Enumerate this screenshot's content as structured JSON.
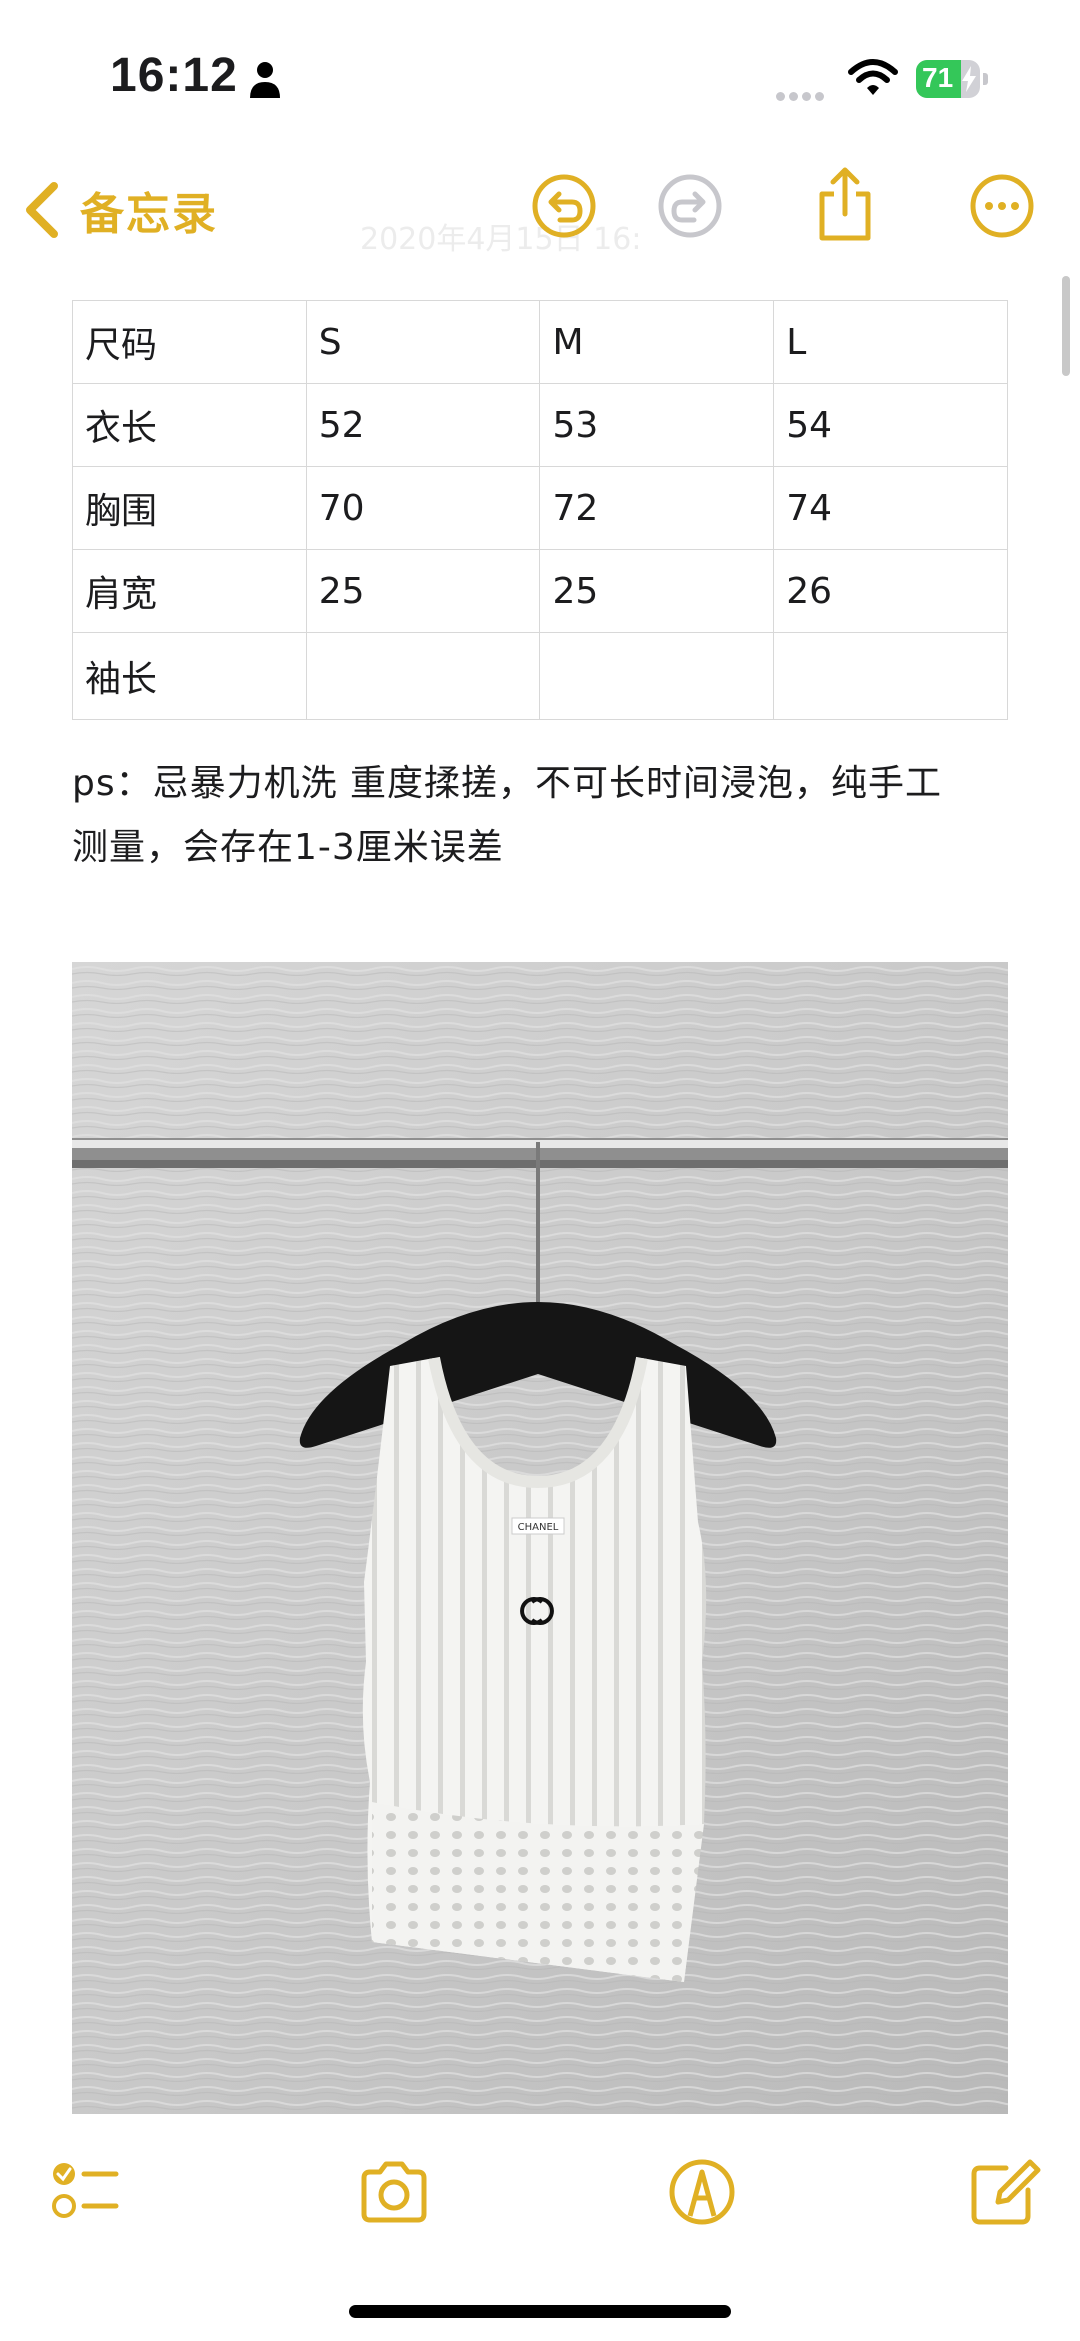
{
  "status_bar": {
    "time": "16:12",
    "battery": "71",
    "battery_level": 0.71
  },
  "nav": {
    "back_label": "备忘录",
    "ghost_date": "2020年4月15日 16:"
  },
  "icons": {
    "back": "chevron-left-icon",
    "undo": "undo-icon",
    "redo": "redo-icon",
    "share": "share-icon",
    "more": "more-icon",
    "checklist": "checklist-icon",
    "camera": "camera-icon",
    "markup": "markup-icon",
    "compose": "compose-icon"
  },
  "colors": {
    "accent": "#e0b024",
    "battery_green": "#34c759"
  },
  "table": {
    "rows": [
      [
        "尺码",
        "S",
        "M",
        "L"
      ],
      [
        "衣长",
        "52",
        "53",
        "54"
      ],
      [
        "胸围",
        "70",
        "72",
        "74"
      ],
      [
        "肩宽",
        "25",
        "25",
        "26"
      ],
      [
        "袖长",
        "",
        "",
        ""
      ]
    ]
  },
  "note": {
    "line1": "ps：忌暴力机洗 重度揉搓，不可长时间浸泡，纯手工",
    "line2": "测量，会存在1-3厘米误差"
  },
  "photo": {
    "label_text": "CHANEL"
  }
}
